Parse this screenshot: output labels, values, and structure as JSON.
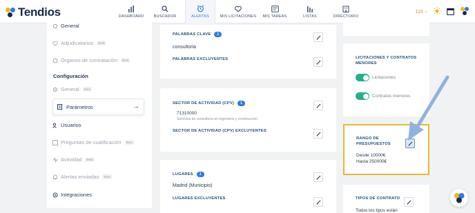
{
  "app": {
    "name": "Tendios",
    "credits": "110",
    "colors": {
      "brand": "#162a4a",
      "accent": "#2f7ae5",
      "toggle": "#24b089",
      "highlight": "#e8b830"
    }
  },
  "nav": [
    {
      "label": "DASHBOARD",
      "icon": "bar-chart-icon"
    },
    {
      "label": "BUSCADOR",
      "icon": "search-icon"
    },
    {
      "label": "ALERTAS",
      "icon": "alarm-clock-icon"
    },
    {
      "label": "MIS LICITACIONES",
      "icon": "heart-icon"
    },
    {
      "label": "MIS TAREAS",
      "icon": "task-icon"
    },
    {
      "label": "LISTAS",
      "icon": "list-bars-icon"
    },
    {
      "label": "DIRECTORIO",
      "icon": "building-icon"
    }
  ],
  "sidebar": {
    "items_top": [
      {
        "label": "General",
        "beta": ""
      },
      {
        "label": "Adjudicatarios",
        "beta": "Beta"
      },
      {
        "label": "Órganos de contratación",
        "beta": "Beta"
      }
    ],
    "section_title": "Configuración",
    "items_config": [
      {
        "label": "General",
        "beta": "Beta"
      },
      {
        "label": "Parámetros",
        "beta": ""
      },
      {
        "label": "Usuarios",
        "beta": ""
      },
      {
        "label": "Preguntas de cualificación",
        "beta": "Beta"
      },
      {
        "label": "Actividad",
        "beta": "Beta"
      },
      {
        "label": "Alertas enviadas",
        "beta": "Beta"
      },
      {
        "label": "Integraciones",
        "beta": ""
      }
    ]
  },
  "keywords": {
    "title": "PALABRAS CLAVE",
    "count": "1",
    "value": "consultoria",
    "excluded_title": "PALABRAS EXCLUYENTES"
  },
  "sector": {
    "title": "SECTOR DE ACTIVIDAD (CPV)",
    "count": "1",
    "code": "71310000",
    "description": "Servicios de consultoría en ingeniería y construcción",
    "excluded_title": "SECTOR DE ACTIVIDAD (CPV) EXCLUYENTES"
  },
  "places": {
    "title": "LUGARES",
    "count": "1",
    "value": "Madrid (Municipio)",
    "excluded_title": "LUGARES EXCLUYENTES"
  },
  "contracts": {
    "title": "LICITACIONES Y CONTRATOS MENORES",
    "toggles": [
      {
        "label": "Licitaciones",
        "on": true
      },
      {
        "label": "Contratos menores",
        "on": true
      }
    ]
  },
  "budget": {
    "title": "RANGO DE PRESUPUESTOS",
    "from": "Desde 10000€",
    "to": "Hasta 250000€"
  },
  "contract_types": {
    "title": "TIPOS DE CONTRATO",
    "value": "Todos los tipos están"
  }
}
